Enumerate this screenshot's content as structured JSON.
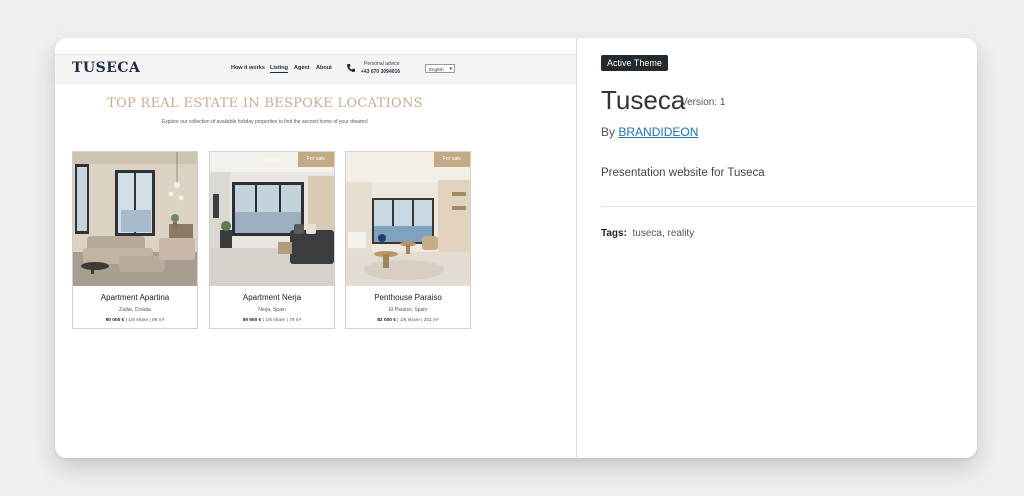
{
  "preview": {
    "logo": "TUSECA",
    "nav": [
      "How it works",
      "Listing",
      "Agent",
      "About"
    ],
    "advice_label": "Personal advice",
    "advice_phone": "+43 670 3094016",
    "language": "English",
    "hero_title": "TOP REAL ESTATE IN BESPOKE LOCATIONS",
    "hero_subtitle": "Explore our collection of available holiday properties to find the second home of your dreams!",
    "listings": [
      {
        "name": "Apartment Apartina",
        "location": "Zadar, Croatia",
        "price": "90 000 €",
        "details": "| 1/8 share | 89 m²",
        "badge": ""
      },
      {
        "name": "Apartment Nerja",
        "location": "Nerja, Spain",
        "price": "59 900 €",
        "details": "| 1/8 share | 79 m²",
        "badge": "For sale"
      },
      {
        "name": "Penthouse Paraiso",
        "location": "El Paraiso, Spain",
        "price": "82 000 €",
        "details": "| 1/8 share | 201 m²",
        "badge": "For sale"
      }
    ]
  },
  "theme": {
    "badge": "Active Theme",
    "name": "Tuseca",
    "version": "Version: 1",
    "by": "By",
    "author": "BRANDIDEON",
    "description": "Presentation website for Tuseca",
    "tags_label": "Tags:",
    "tags": "tuseca, reality"
  },
  "colors": {
    "accent": "#c4a985",
    "navy": "#1f2a44",
    "link": "#2271b1",
    "badge_bg": "#222a2f"
  }
}
